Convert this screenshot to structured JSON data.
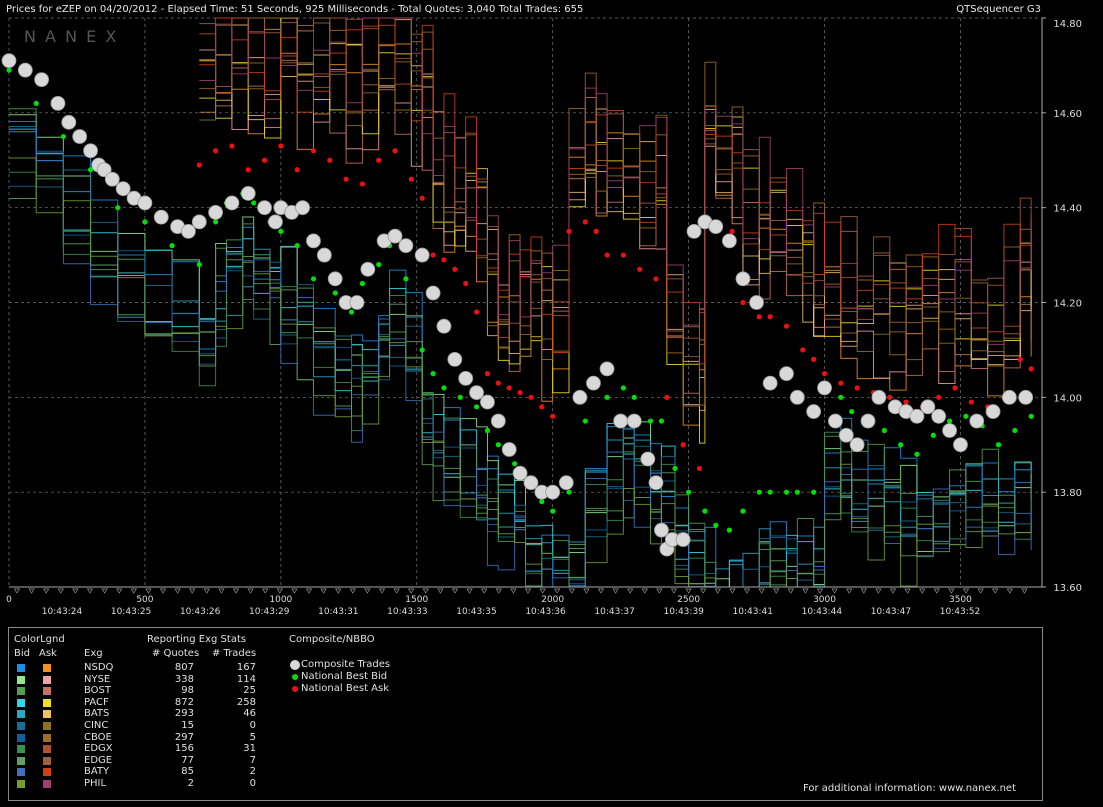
{
  "header": {
    "title": "Prices for  eZEP  on 04/20/2012  -  Elapsed Time: 51 Seconds, 925 Milliseconds  -  Total Quotes: 3,040  Total Trades: 655",
    "app": "QTSequencer G3",
    "watermark": "N A N E X"
  },
  "footer": {
    "info": "For additional information: www.nanex.net"
  },
  "chart_data": {
    "type": "line",
    "title": "Prices for  eZEP  on 04/20/2012",
    "x_ticks": [
      "0",
      "500",
      "1000",
      "1500",
      "2000",
      "2500",
      "3000",
      "3500"
    ],
    "x_tick_values": [
      0,
      500,
      1000,
      1500,
      2000,
      2500,
      3000,
      3500
    ],
    "time_labels": [
      "10:43:24",
      "10:43:25",
      "10:43:26",
      "10:43:29",
      "10:43:31",
      "10:43:33",
      "10:43:35",
      "10:43:36",
      "10:43:37",
      "10:43:39",
      "10:43:41",
      "10:43:44",
      "10:43:47",
      "10:43:52"
    ],
    "y_ticks": [
      "14.80",
      "14.60",
      "14.40",
      "14.20",
      "14.00",
      "13.80",
      "13.60"
    ],
    "ylim": [
      13.6,
      14.8
    ],
    "xlim": [
      0,
      3800
    ],
    "grid": true,
    "series": [
      {
        "name": "Composite Trades",
        "color": "#d8d8d8",
        "x": [
          0,
          60,
          120,
          180,
          220,
          260,
          300,
          330,
          350,
          380,
          420,
          460,
          500,
          560,
          620,
          660,
          700,
          760,
          820,
          880,
          940,
          980,
          1000,
          1040,
          1080,
          1120,
          1160,
          1200,
          1240,
          1280,
          1320,
          1380,
          1420,
          1460,
          1520,
          1560,
          1600,
          1640,
          1680,
          1720,
          1760,
          1800,
          1840,
          1880,
          1920,
          1960,
          2000,
          2050,
          2100,
          2150,
          2200,
          2250,
          2300,
          2350,
          2380,
          2400,
          2420,
          2440,
          2480,
          2520,
          2560,
          2600,
          2650,
          2700,
          2750,
          2800,
          2860,
          2900,
          2960,
          3000,
          3040,
          3080,
          3120,
          3160,
          3200,
          3260,
          3300,
          3340,
          3380,
          3420,
          3460,
          3500,
          3560,
          3620,
          3680,
          3740
        ],
        "y": [
          14.71,
          14.69,
          14.67,
          14.62,
          14.58,
          14.55,
          14.52,
          14.49,
          14.48,
          14.46,
          14.44,
          14.42,
          14.41,
          14.38,
          14.36,
          14.35,
          14.37,
          14.39,
          14.41,
          14.43,
          14.4,
          14.37,
          14.4,
          14.39,
          14.4,
          14.33,
          14.3,
          14.25,
          14.2,
          14.2,
          14.27,
          14.33,
          14.34,
          14.32,
          14.3,
          14.22,
          14.15,
          14.08,
          14.04,
          14.01,
          13.99,
          13.95,
          13.89,
          13.84,
          13.82,
          13.8,
          13.8,
          13.82,
          14.0,
          14.03,
          14.06,
          13.95,
          13.95,
          13.87,
          13.82,
          13.72,
          13.68,
          13.7,
          13.7,
          14.35,
          14.37,
          14.36,
          14.33,
          14.25,
          14.2,
          14.03,
          14.05,
          14.0,
          13.97,
          14.02,
          13.95,
          13.92,
          13.9,
          13.95,
          14.0,
          13.98,
          13.97,
          13.96,
          13.98,
          13.96,
          13.93,
          13.9,
          13.95,
          13.97,
          14.0,
          14.0
        ]
      },
      {
        "name": "National Best Bid",
        "color": "#00e000",
        "x": [
          0,
          100,
          200,
          300,
          400,
          500,
          600,
          700,
          760,
          800,
          860,
          900,
          960,
          1000,
          1060,
          1120,
          1200,
          1260,
          1300,
          1360,
          1400,
          1460,
          1520,
          1560,
          1600,
          1660,
          1720,
          1760,
          1800,
          1860,
          1900,
          1960,
          2000,
          2060,
          2120,
          2200,
          2260,
          2300,
          2360,
          2400,
          2450,
          2500,
          2560,
          2600,
          2650,
          2700,
          2760,
          2800,
          2860,
          2900,
          2960,
          3000,
          3060,
          3100,
          3160,
          3220,
          3280,
          3340,
          3400,
          3460,
          3520,
          3580,
          3640,
          3700,
          3760
        ],
        "y": [
          14.69,
          14.62,
          14.55,
          14.48,
          14.4,
          14.37,
          14.32,
          14.28,
          14.37,
          14.41,
          14.43,
          14.41,
          14.37,
          14.35,
          14.32,
          14.25,
          14.22,
          14.18,
          14.24,
          14.28,
          14.32,
          14.25,
          14.1,
          14.05,
          14.02,
          14.0,
          13.98,
          13.93,
          13.9,
          13.86,
          13.83,
          13.78,
          13.76,
          13.8,
          13.95,
          14.0,
          14.02,
          14.0,
          13.95,
          13.95,
          13.85,
          13.8,
          13.76,
          13.73,
          13.72,
          13.76,
          13.8,
          13.8,
          13.8,
          13.8,
          13.8,
          14.02,
          14.0,
          13.97,
          13.95,
          13.93,
          13.9,
          13.88,
          13.92,
          13.95,
          13.96,
          13.94,
          13.9,
          13.93,
          13.96
        ]
      },
      {
        "name": "National Best Ask",
        "color": "#ee1010",
        "x": [
          700,
          760,
          820,
          880,
          940,
          1000,
          1060,
          1120,
          1180,
          1240,
          1300,
          1360,
          1420,
          1480,
          1520,
          1560,
          1600,
          1640,
          1680,
          1720,
          1760,
          1800,
          1840,
          1880,
          1920,
          1960,
          2000,
          2060,
          2120,
          2160,
          2200,
          2260,
          2320,
          2380,
          2420,
          2480,
          2540,
          2560,
          2600,
          2660,
          2700,
          2760,
          2800,
          2860,
          2920,
          2960,
          3000,
          3060,
          3120,
          3180,
          3240,
          3300,
          3360,
          3420,
          3480,
          3540,
          3600,
          3660,
          3720,
          3760
        ],
        "y": [
          14.49,
          14.52,
          14.53,
          14.48,
          14.5,
          14.53,
          14.48,
          14.52,
          14.5,
          14.46,
          14.45,
          14.5,
          14.52,
          14.46,
          14.42,
          14.3,
          14.29,
          14.27,
          14.24,
          14.18,
          14.05,
          14.03,
          14.02,
          14.01,
          14.0,
          13.98,
          13.96,
          14.35,
          14.37,
          14.35,
          14.3,
          14.3,
          14.27,
          14.25,
          14.0,
          13.9,
          13.85,
          14.38,
          14.35,
          14.35,
          14.2,
          14.17,
          14.17,
          14.15,
          14.1,
          14.08,
          14.05,
          14.03,
          14.02,
          14.01,
          14.0,
          13.99,
          13.98,
          14.0,
          14.02,
          13.99,
          13.98,
          14.0,
          14.08,
          14.06
        ]
      }
    ],
    "legend": {
      "header": [
        "ColorLgnd",
        "Reporting Exg Stats",
        "Composite/NBBO"
      ],
      "sub": [
        "Bid",
        "Ask",
        "Exg",
        "# Quotes",
        "# Trades"
      ],
      "rows": [
        {
          "exg": "NSDQ",
          "quotes": "807",
          "trades": "167",
          "bid": "#1e8fe0",
          "ask": "#f09020"
        },
        {
          "exg": "NYSE",
          "quotes": "338",
          "trades": "114",
          "bid": "#90e890",
          "ask": "#f0a0a0"
        },
        {
          "exg": "BOST",
          "quotes": "98",
          "trades": "25",
          "bid": "#50a050",
          "ask": "#c87060"
        },
        {
          "exg": "PACF",
          "quotes": "872",
          "trades": "258",
          "bid": "#30d8f0",
          "ask": "#f0e020"
        },
        {
          "exg": "BATS",
          "quotes": "293",
          "trades": "46",
          "bid": "#2aa6c8",
          "ask": "#f0c060"
        },
        {
          "exg": "CINC",
          "quotes": "15",
          "trades": "0",
          "bid": "#1a7090",
          "ask": "#907020"
        },
        {
          "exg": "CBOE",
          "quotes": "297",
          "trades": "5",
          "bid": "#1060a0",
          "ask": "#a07020"
        },
        {
          "exg": "EDGX",
          "quotes": "156",
          "trades": "31",
          "bid": "#3a9050",
          "ask": "#b05030"
        },
        {
          "exg": "EDGE",
          "quotes": "77",
          "trades": "7",
          "bid": "#60a060",
          "ask": "#a06040"
        },
        {
          "exg": "BATY",
          "quotes": "85",
          "trades": "2",
          "bid": "#4070c0",
          "ask": "#d04010"
        },
        {
          "exg": "PHIL",
          "quotes": "2",
          "trades": "0",
          "bid": "#70a030",
          "ask": "#a04070"
        }
      ],
      "nbbo": [
        "Composite Trades",
        "National Best Bid",
        "National Best Ask"
      ]
    }
  }
}
